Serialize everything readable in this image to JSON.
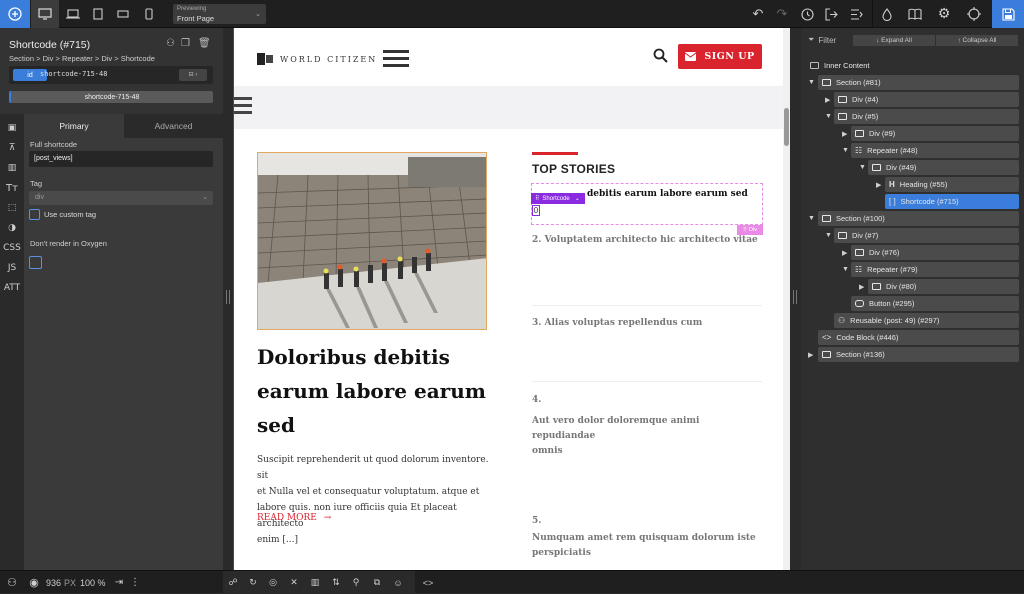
{
  "toolbar": {
    "previewing_label": "Previewing",
    "previewing_value": "Front Page"
  },
  "left_panel": {
    "title": "Shortcode (#715)",
    "breadcrumb": "Section > Div > Repeater > Div > Shortcode",
    "selector_badge": "id",
    "selector_value": "shortcode-715-48",
    "selector_bar": "shortcode-715-48",
    "tab_primary": "Primary",
    "tab_advanced": "Advanced",
    "full_shortcode_label": "Full shortcode",
    "full_shortcode_value": "[post_views]",
    "tag_label": "Tag",
    "tag_value": "div",
    "use_custom_tag": "Use custom tag",
    "dont_render": "Don't render in Oxygen",
    "side_css": "CSS",
    "side_js": "JS",
    "side_att": "ATT"
  },
  "canvas": {
    "signup": "SIGN UP",
    "logo_text": "WORLD CITIZEN",
    "feature_title_lines": [
      "Doloribus debitis",
      "earum labore earum",
      "sed"
    ],
    "excerpt_lines": [
      "Suscipit reprehenderit ut quod dolorum inventore. sit",
      "et Nulla vel et consequatur voluptatum. atque et",
      "labore quis. non iure officiis quia Et placeat architecto",
      "enim [...]"
    ],
    "read_more": "READ MORE",
    "read_more_arrow": "→",
    "top_stories": "TOP STORIES",
    "story1": "debitis earum labore earum sed",
    "shortcode_tag": "Shortcode",
    "shortcode_value": "0",
    "div_tag": "Div",
    "story2": "2. Voluptatem architecto hic architecto vitae",
    "story3": "3. Alias voluptas repellendus cum",
    "story4_num": "4.",
    "story4_lines": [
      "Aut vero dolor doloremque animi repudiandae",
      "omnis"
    ],
    "story5_num": "5.",
    "story5_lines": [
      "Numquam amet rem quisquam dolorum iste",
      "perspiciatis"
    ]
  },
  "right_panel": {
    "filter": "Filter",
    "expand_all": "↓ Expand All",
    "collapse_all": "↑ Collapse All",
    "inner_content": "Inner Content",
    "tree": [
      "Section (#81)",
      "Div (#4)",
      "Div (#5)",
      "Div (#9)",
      "Repeater (#48)",
      "Div (#49)",
      "Heading (#55)",
      "Shortcode (#715)",
      "Section (#100)",
      "Div (#7)",
      "Div (#76)",
      "Repeater (#79)",
      "Div (#80)",
      "Button (#295)",
      "Reusable (post: 49) (#297)",
      "Code Block (#446)",
      "Section (#136)"
    ]
  },
  "bottom": {
    "width_value": "936",
    "width_unit": "PX",
    "zoom": "100 %"
  },
  "colors": {
    "accent_blue": "#3a7ddb",
    "signup_red": "#d9232d",
    "shortcode_purple": "#8a2be2",
    "div_pink": "#e98ae6"
  }
}
